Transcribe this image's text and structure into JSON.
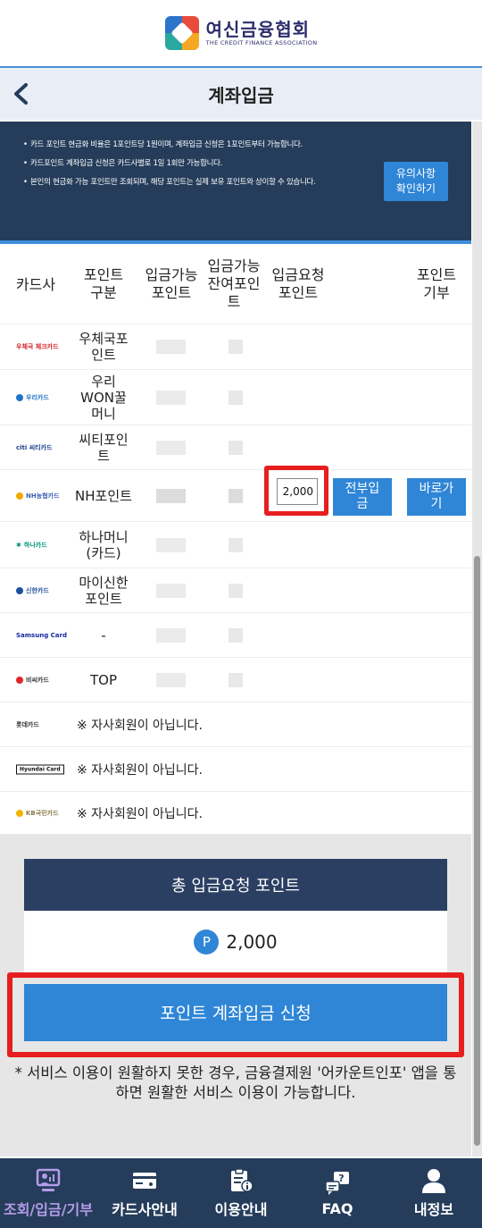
{
  "logo": {
    "name": "여신금융협회",
    "subtitle": "THE CREDIT FINANCE ASSOCIATION"
  },
  "header": {
    "title": "계좌입금"
  },
  "notice": {
    "items": [
      "카드 포인트 현금화 비율은 1포인트당 1원이며, 계좌입금 신청은 1포인트부터 가능합니다.",
      "카드포인트 계좌입금 신청은 카드사별로 1일 1회만 가능합니다.",
      "본인의 현금화 가능 포인트만 조회되며, 해당 포인트는 실제 보유 포인트와 상이할 수 있습니다."
    ],
    "caution_button": "유의사항\n확인하기"
  },
  "table": {
    "headers": [
      "카드사",
      "포인트\n구분",
      "입금가능\n포인트",
      "입금가능\n잔여포인\n트",
      "입금요청\n포인트",
      "포인트\n기부"
    ],
    "rows": [
      {
        "card": "우체국 체크카드",
        "color": "#d2232a",
        "point_type": "우체국포\n인트"
      },
      {
        "card": "우리카드",
        "color": "#1e74c6",
        "point_type": "우리\nWON꿀\n머니"
      },
      {
        "card": "citi 씨티카드",
        "color": "#1a3e8c",
        "point_type": "씨티포인\n트"
      },
      {
        "card": "NH농협카드",
        "color": "#f2a900",
        "point_type": "NH포인트",
        "request_value": "2,000",
        "all_deposit_button": "전부입\n금",
        "donate_button": "바로가\n기"
      },
      {
        "card": "하나카드",
        "color": "#00957a",
        "point_type": "하나머니\n(카드)"
      },
      {
        "card": "신한카드",
        "color": "#1f4fa0",
        "point_type": "마이신한\n포인트"
      },
      {
        "card": "Samsung Card",
        "color": "#1428a0",
        "point_type": "-"
      },
      {
        "card": "비씨카드",
        "color": "#e0262a",
        "point_type": "TOP"
      },
      {
        "card": "롯데카드",
        "color": "#d9232a",
        "point_type": "",
        "note": "※ 자사회원이 아닙니다."
      },
      {
        "card": "Hyundai Card",
        "color": "#111111",
        "point_type": "",
        "note": "※ 자사회원이 아닙니다."
      },
      {
        "card": "KB국민카드",
        "color": "#f2b300",
        "point_type": "",
        "note": "※ 자사회원이 아닙니다."
      }
    ]
  },
  "summary": {
    "title": "총 입금요청 포인트",
    "icon_label": "P",
    "value": "2,000"
  },
  "apply_button": "포인트 계좌입금 신청",
  "footnote": "* 서비스 이용이 원활하지 못한 경우, 금융결제원 '어카운트인포' 앱을 통하면 원활한 서비스 이용이 가능합니다.",
  "nav": [
    {
      "label": "조회/입금/기부",
      "icon": "monitor-person-icon",
      "active": true
    },
    {
      "label": "카드사안내",
      "icon": "card-icon",
      "active": false
    },
    {
      "label": "이용안내",
      "icon": "clipboard-info-icon",
      "active": false
    },
    {
      "label": "FAQ",
      "icon": "chat-question-icon",
      "active": false
    },
    {
      "label": "내정보",
      "icon": "user-icon",
      "active": false
    }
  ],
  "colors": {
    "accent": "#2f86d6",
    "navy": "#253d5b",
    "highlight": "#e61e1e",
    "active_nav": "#b49ce8"
  }
}
